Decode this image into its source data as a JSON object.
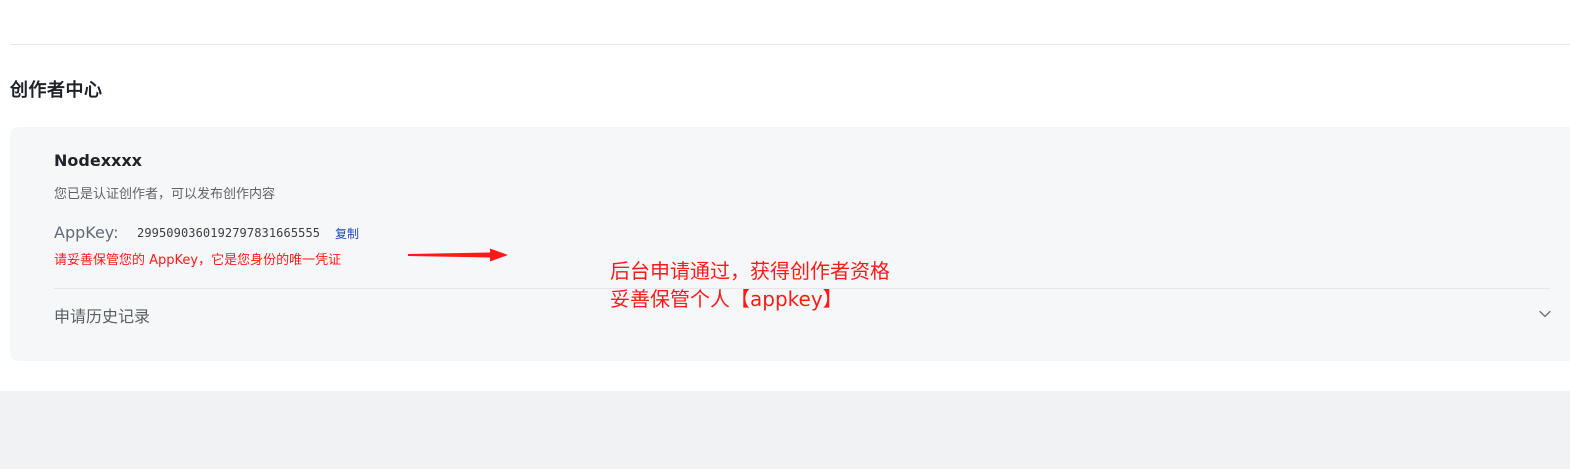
{
  "creator_center": {
    "title": "创作者中心",
    "name": "Nodexxxx",
    "status": "您已是认证创作者，可以发布创作内容",
    "appkey": {
      "label": "AppKey:",
      "value": "2995090360192797831665555",
      "copy_label": "复制",
      "warning": "请妥善保管您的 AppKey，它是您身份的唯一凭证"
    },
    "history": {
      "label": "申请历史记录"
    }
  },
  "annotation": {
    "line1": "后台申请通过，获得创作者资格",
    "line2": "妥善保管个人【appkey】",
    "color": "#ff1a1a"
  },
  "icons": {
    "history_toggle": "chevron-down-icon",
    "annotation_pointer": "arrow-right-icon"
  }
}
